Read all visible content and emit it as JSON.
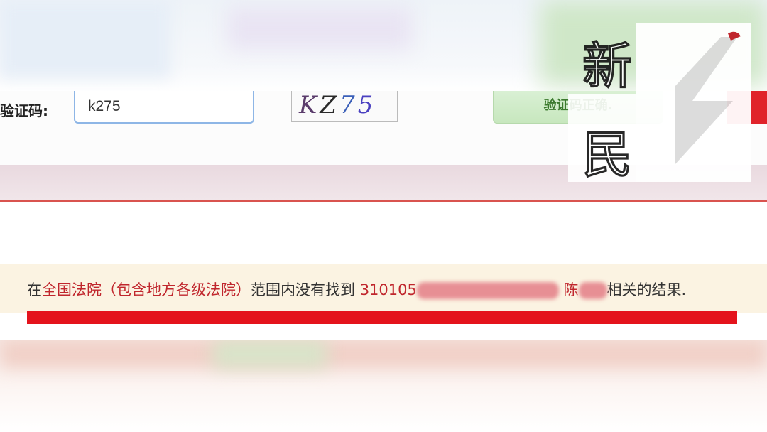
{
  "captcha": {
    "label": "验证码:",
    "input_value": "k275",
    "image_text": [
      "K",
      "Z",
      "7",
      "5"
    ],
    "status": "验证码正确."
  },
  "result": {
    "prefix": "在",
    "scope": "全国法院（包含地方各级法院）",
    "middle": "范围内没有找到",
    "id_prefix": "310105",
    "name": "陈",
    "suffix": "相关的结果."
  },
  "watermark": {
    "icon": "xinmin-logo-icon",
    "chars": [
      "新",
      "民"
    ]
  },
  "colors": {
    "accent_red": "#e4131c",
    "success_green": "#3c7a2e",
    "input_border": "#8eb6e6"
  }
}
